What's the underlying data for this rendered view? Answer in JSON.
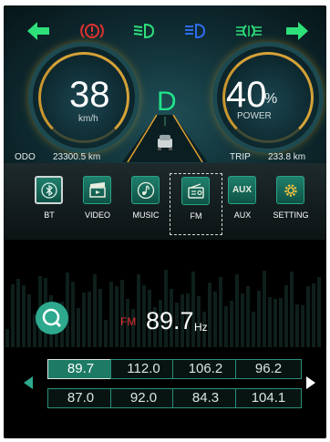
{
  "indicators": {
    "left_turn": "left-arrow-icon",
    "brake": "brake-warning-icon",
    "low_beam": "low-beam-icon",
    "high_beam": "high-beam-icon",
    "fog": "fog-light-icon",
    "right_turn": "right-arrow-icon"
  },
  "speed": {
    "value": "38",
    "unit": "km/h"
  },
  "gear": "D",
  "power": {
    "value": "40",
    "percent": "%",
    "label": "POWER"
  },
  "odo": {
    "label": "ODO",
    "value": "23300.5 km"
  },
  "trip": {
    "label": "TRIP",
    "value": "233.8 km"
  },
  "functions": [
    {
      "label": "BT",
      "icon": "bluetooth-icon"
    },
    {
      "label": "VIDEO",
      "icon": "clapperboard-icon"
    },
    {
      "label": "MUSIC",
      "icon": "music-note-icon"
    },
    {
      "label": "FM",
      "icon": "radio-icon",
      "selected": true
    },
    {
      "label": "AUX",
      "icon": "aux-icon",
      "icon_text": "AUX"
    },
    {
      "label": "SETTING",
      "icon": "gear-icon"
    }
  ],
  "radio": {
    "band": "FM",
    "frequency": "89.7",
    "unit": "Hz",
    "presets": [
      "89.7",
      "112.0",
      "106.2",
      "96.2",
      "87.0",
      "92.0",
      "84.3",
      "104.1"
    ],
    "active_preset": "89.7"
  },
  "colors": {
    "accent_green": "#22e08a",
    "teal": "#2ea98e",
    "gauge_gold": "#d5a238",
    "warning_red": "#e23030",
    "beam_blue": "#2f6cf0"
  }
}
